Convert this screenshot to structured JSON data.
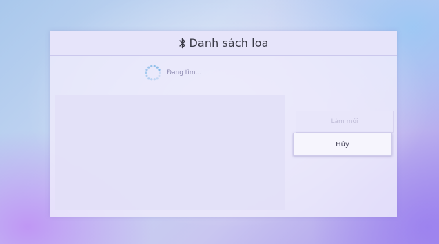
{
  "dialog": {
    "title": "Danh sách loa",
    "title_icon": "bluetooth-icon",
    "status_icon": "loading-spinner-icon",
    "status_text": "Đang tìm...",
    "device_list": [],
    "buttons": {
      "refresh_label": "Làm mới",
      "cancel_label": "Hủy"
    }
  },
  "colors": {
    "dialog_background": "#ecebfc",
    "title_text": "#3a3a46",
    "spinner": "#7fb7e6",
    "disabled_text": "#c0bdd8",
    "button_text": "#3e3c52"
  }
}
